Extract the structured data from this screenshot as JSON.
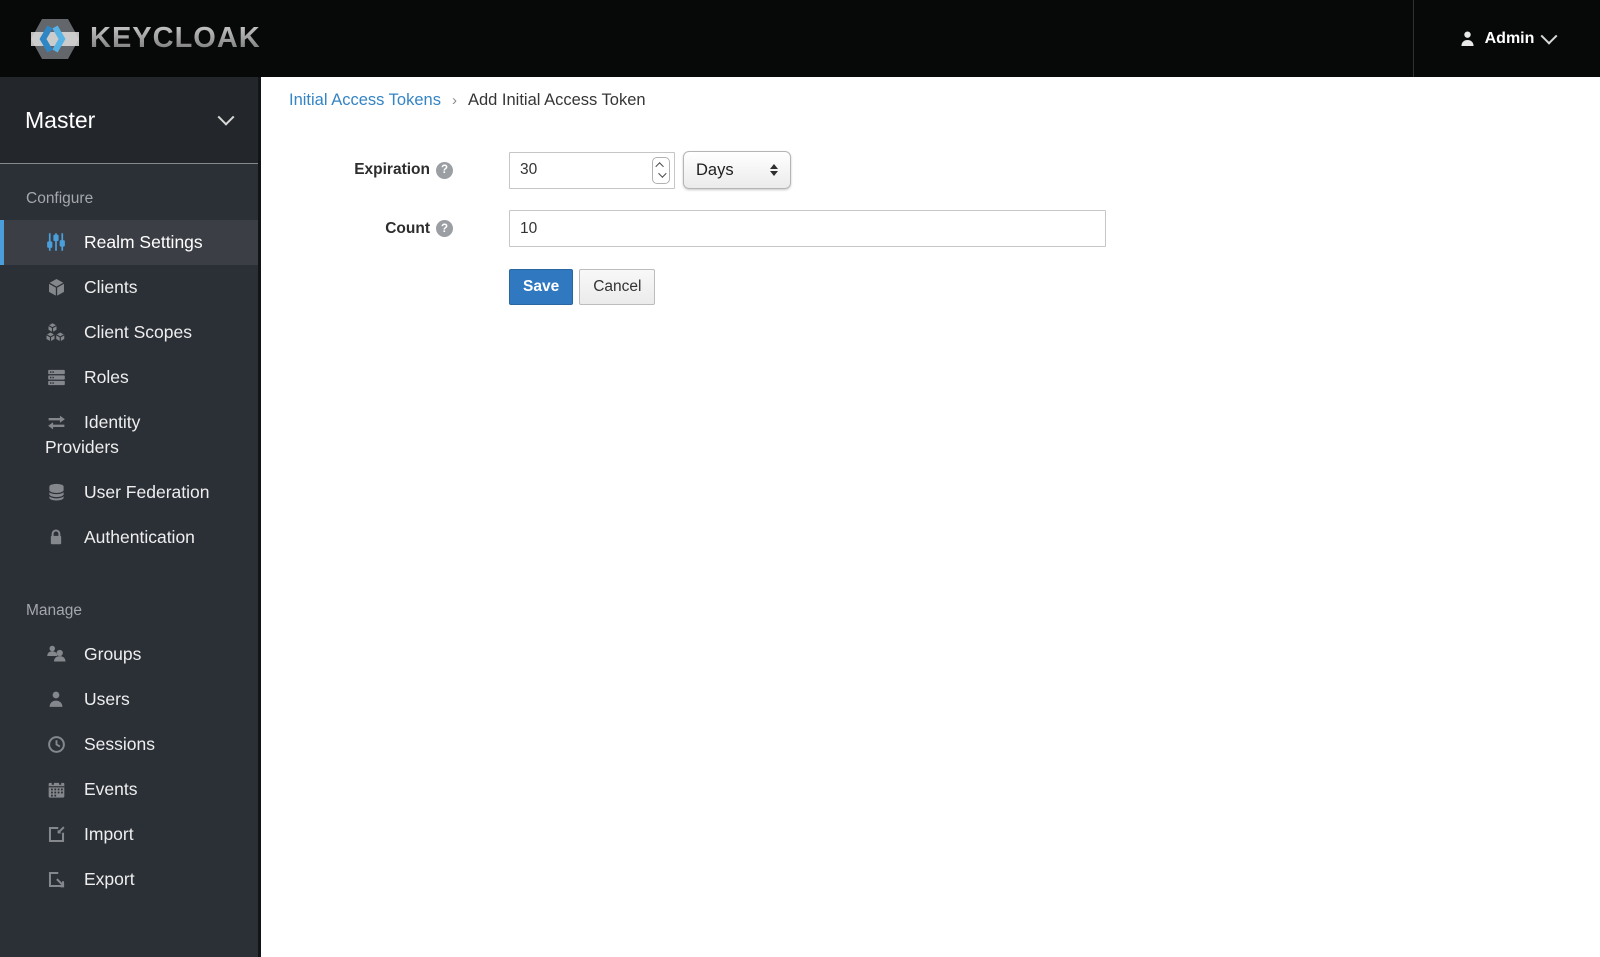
{
  "topbar": {
    "logo_text": "KEYCLOAK",
    "user_name": "Admin"
  },
  "sidebar": {
    "realm": "Master",
    "sections": [
      {
        "label": "Configure",
        "items": [
          {
            "label": "Realm Settings",
            "icon": "sliders-icon",
            "active": true
          },
          {
            "label": "Clients",
            "icon": "cube-icon",
            "active": false
          },
          {
            "label": "Client Scopes",
            "icon": "cubes-icon",
            "active": false
          },
          {
            "label": "Roles",
            "icon": "server-icon",
            "active": false
          },
          {
            "label": "Identity Providers",
            "icon": "exchange-arrows-icon",
            "active": false
          },
          {
            "label": "User Federation",
            "icon": "database-icon",
            "active": false
          },
          {
            "label": "Authentication",
            "icon": "lock-icon",
            "active": false
          }
        ]
      },
      {
        "label": "Manage",
        "items": [
          {
            "label": "Groups",
            "icon": "group-icon",
            "active": false
          },
          {
            "label": "Users",
            "icon": "user-icon",
            "active": false
          },
          {
            "label": "Sessions",
            "icon": "clock-icon",
            "active": false
          },
          {
            "label": "Events",
            "icon": "calendar-icon",
            "active": false
          },
          {
            "label": "Import",
            "icon": "import-icon",
            "active": false
          },
          {
            "label": "Export",
            "icon": "export-icon",
            "active": false
          }
        ]
      }
    ]
  },
  "breadcrumb": {
    "link": "Initial Access Tokens",
    "separator": "›",
    "current": "Add Initial Access Token"
  },
  "form": {
    "expiration": {
      "label": "Expiration",
      "value": "30",
      "unit": "Days"
    },
    "count": {
      "label": "Count",
      "value": "10"
    },
    "save_label": "Save",
    "cancel_label": "Cancel"
  },
  "colors": {
    "topbar_bg": "#070808",
    "sidebar_bg": "#2b2f36",
    "active_item_bg": "#3b3e45",
    "accent_blue": "#4a9ed9",
    "link_blue": "#3584c4",
    "primary_button": "#3079c0"
  }
}
